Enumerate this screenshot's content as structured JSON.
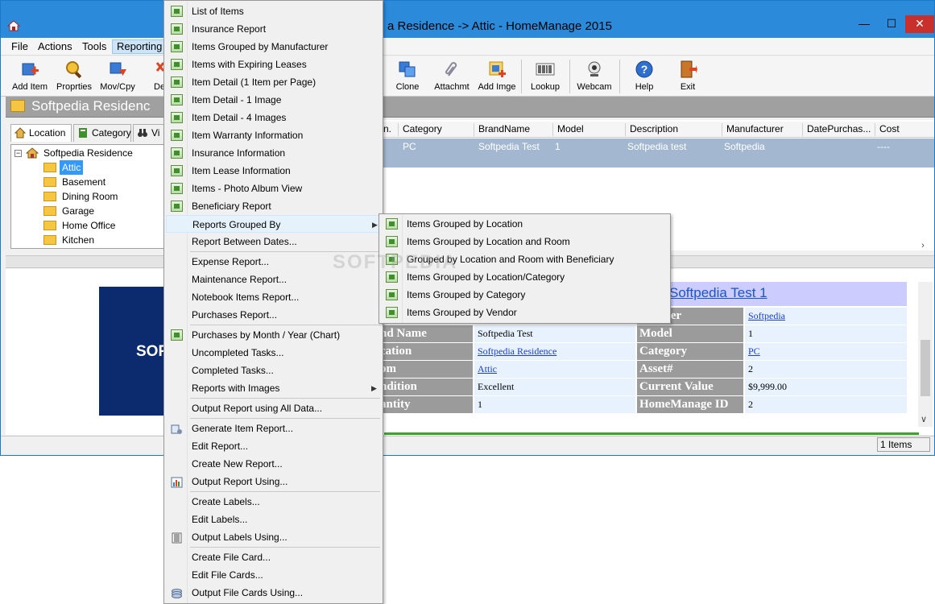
{
  "window": {
    "title": "Softpedia Residence -> Attic - HomeManage 2015",
    "title_visible": "a Residence -> Attic - HomeManage 2015",
    "minimize": "—",
    "maximize": "☐",
    "close": "✕"
  },
  "menubar": {
    "file": "File",
    "actions": "Actions",
    "tools": "Tools",
    "reporting": "Reporting"
  },
  "toolbar": {
    "add_item": "Add Item",
    "properties": "Proprties",
    "move_copy": "Mov/Cpy",
    "delete": "De",
    "clone": "Clone",
    "attachment": "Attachmt",
    "add_image": "Add Imge",
    "lookup": "Lookup",
    "webcam": "Webcam",
    "help": "Help",
    "exit": "Exit"
  },
  "header": {
    "title": "Softpedia Residenc"
  },
  "left_tabs": {
    "location": "Location",
    "category": "Category",
    "view": "Vi"
  },
  "tree": {
    "root": "Softpedia Residence",
    "expander": "−",
    "items": [
      "Attic",
      "Basement",
      "Dining Room",
      "Garage",
      "Home Office",
      "Kitchen"
    ],
    "selected": "Attic"
  },
  "grid": {
    "columns": [
      "n.",
      "Category",
      "BrandName",
      "Model",
      "Description",
      "Manufacturer",
      "DatePurchas...",
      "Cost"
    ],
    "row": {
      "category": "PC",
      "brand": "Softpedia Test",
      "model": "1",
      "description": "Softpedia test",
      "manufacturer": "Softpedia",
      "cost": "----"
    },
    "scroll_arrow": "›"
  },
  "detail": {
    "logo_text": "SOF",
    "title": "Softpedia Test 1",
    "rows": [
      {
        "label_left": "",
        "value_left": "",
        "label_right": "facturer",
        "value_right": "Softpedia"
      },
      {
        "label_left": "nd Name",
        "value_left": "Softpedia Test",
        "label_right": "Model",
        "value_right": "1"
      },
      {
        "label_left": "cation",
        "value_left": "Softpedia Residence",
        "label_right": "Category",
        "value_right": "PC"
      },
      {
        "label_left": "om",
        "value_left": "Attic",
        "label_right": "Asset#",
        "value_right": "2"
      },
      {
        "label_left": "ndition",
        "value_left": "Excellent",
        "label_right": "Current Value",
        "value_right": "$9,999.00"
      },
      {
        "label_left": "antity",
        "value_left": "1",
        "label_right": "HomeManage ID",
        "value_right": "2"
      }
    ],
    "scroll_down": "∨"
  },
  "status": {
    "items": "1 Items"
  },
  "reporting_menu": {
    "items": [
      "List of Items",
      "Insurance Report",
      "Items Grouped by Manufacturer",
      "Items with Expiring Leases",
      "Item Detail (1 Item per Page)",
      "Item Detail - 1 Image",
      "Item Detail - 4 Images",
      "Item Warranty Information",
      "Insurance Information",
      "Item Lease Information",
      "Items - Photo Album View",
      "Beneficiary Report",
      "Reports Grouped By",
      "Report Between Dates...",
      "Expense Report...",
      "Maintenance Report...",
      "Notebook Items Report...",
      "Purchases Report...",
      "Purchases by Month / Year (Chart)",
      "Uncompleted Tasks...",
      "Completed Tasks...",
      "Reports with Images",
      "Output Report using All Data...",
      "Generate Item Report...",
      "Edit Report...",
      "Create New Report...",
      "Output Report Using...",
      "Create Labels...",
      "Edit Labels...",
      "Output Labels Using...",
      "Create File Card...",
      "Edit File Cards...",
      "Output File Cards Using..."
    ],
    "submenu_arrow": "▶"
  },
  "grouped_by_submenu": {
    "items": [
      "Items Grouped by Location",
      "Items Grouped by Location and Room",
      "Grouped by Location and Room with Beneficiary",
      "Items Grouped by Location/Category",
      "Items Grouped by Category",
      "Items Grouped by Vendor"
    ]
  },
  "watermark": "SOFTPEDIA",
  "colors": {
    "titlebar": "#2b8ad9",
    "close_button": "#c7302b",
    "selection": "#3399ff",
    "grid_selected_row": "#a3b8d0",
    "detail_title_bg": "#ccccff",
    "label_bg": "#9b9b9b",
    "value_bg": "#e8f2ff",
    "logo_bg": "#0c2a6e"
  }
}
